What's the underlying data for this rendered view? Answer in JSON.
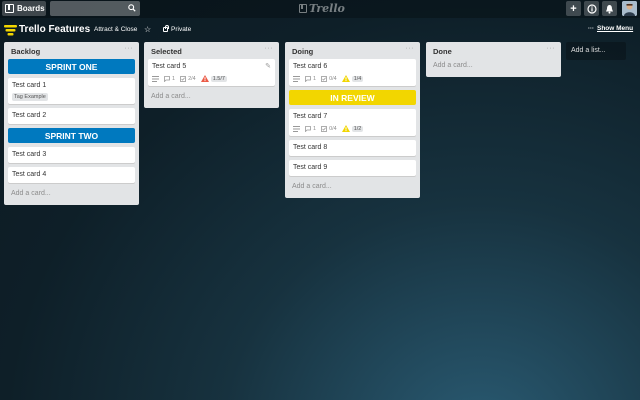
{
  "header": {
    "boards_label": "Boards",
    "search_placeholder": "",
    "logo_text": "Trello",
    "add_icon": "+",
    "info_icon": "i",
    "bell_icon": "bell"
  },
  "board": {
    "title": "Trello Features",
    "tag": "Attract & Close",
    "visibility": "Private",
    "show_menu_dots": "···",
    "show_menu_label": "Show Menu"
  },
  "colors": {
    "blue": "#0079bf",
    "yellow": "#f2d600",
    "list_bg": "#e2e4e6",
    "warn_red": "#eb5a46",
    "warn_yellow": "#f2d600"
  },
  "lists": {
    "backlog": {
      "title": "Backlog",
      "menu": "···",
      "sprint_one": "SPRINT ONE",
      "card1": {
        "title": "Test card 1",
        "tag": "Tag Example"
      },
      "card2": {
        "title": "Test card 2"
      },
      "sprint_two": "SPRINT TWO",
      "card3": {
        "title": "Test card 3"
      },
      "card4": {
        "title": "Test card 4"
      },
      "add": "Add a card..."
    },
    "selected": {
      "title": "Selected",
      "menu": "···",
      "card5": {
        "title": "Test card 5",
        "comments": "1",
        "checklist": "2/4",
        "estimate": "1.5/7"
      },
      "add": "Add a card..."
    },
    "doing": {
      "title": "Doing",
      "menu": "···",
      "card6": {
        "title": "Test card 6",
        "comments": "1",
        "checklist": "0/4",
        "estimate": "1/4"
      },
      "in_review": "IN REVIEW",
      "card7": {
        "title": "Test card 7",
        "comments": "1",
        "checklist": "0/4",
        "estimate": "1/2"
      },
      "card8": {
        "title": "Test card 8"
      },
      "card9": {
        "title": "Test card 9"
      },
      "add": "Add a card..."
    },
    "done": {
      "title": "Done",
      "menu": "···",
      "add": "Add a card..."
    }
  },
  "add_list": "Add a list..."
}
